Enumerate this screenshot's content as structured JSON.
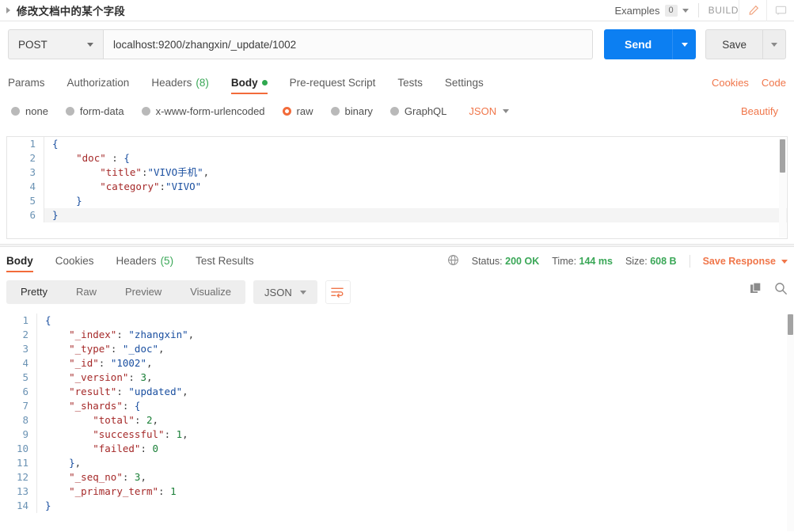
{
  "titlebar": {
    "request_title": "修改文档中的某个字段",
    "examples_label": "Examples",
    "examples_count": "0",
    "build_label": "BUILD",
    "edit_icon": "pencil-icon",
    "comment_icon": "comment-icon"
  },
  "urlbar": {
    "method": "POST",
    "url": "localhost:9200/zhangxin/_update/1002",
    "send_label": "Send",
    "save_label": "Save"
  },
  "request_tabs": {
    "items": [
      {
        "label": "Params",
        "active": false
      },
      {
        "label": "Authorization",
        "active": false
      },
      {
        "label": "Headers",
        "count": "(8)",
        "active": false
      },
      {
        "label": "Body",
        "active": true,
        "dot": true
      },
      {
        "label": "Pre-request Script",
        "active": false
      },
      {
        "label": "Tests",
        "active": false
      },
      {
        "label": "Settings",
        "active": false
      }
    ],
    "cookies_link": "Cookies",
    "code_link": "Code"
  },
  "body_type": {
    "options": [
      {
        "label": "none",
        "selected": false
      },
      {
        "label": "form-data",
        "selected": false
      },
      {
        "label": "x-www-form-urlencoded",
        "selected": false
      },
      {
        "label": "raw",
        "selected": true
      },
      {
        "label": "binary",
        "selected": false
      },
      {
        "label": "GraphQL",
        "selected": false
      }
    ],
    "format": "JSON",
    "beautify_label": "Beautify"
  },
  "request_body": {
    "lines": [
      {
        "no": "1",
        "text": "{"
      },
      {
        "no": "2",
        "text": "    \"doc\" : {"
      },
      {
        "no": "3",
        "text": "        \"title\":\"VIVO手机\","
      },
      {
        "no": "4",
        "text": "        \"category\":\"VIVO\""
      },
      {
        "no": "5",
        "text": "    }"
      },
      {
        "no": "6",
        "text": "}"
      }
    ]
  },
  "response_tabs": {
    "items": [
      {
        "label": "Body",
        "active": true
      },
      {
        "label": "Cookies",
        "active": false
      },
      {
        "label": "Headers",
        "count": "(5)",
        "active": false
      },
      {
        "label": "Test Results",
        "active": false
      }
    ],
    "status_label": "Status:",
    "status_value": "200 OK",
    "time_label": "Time:",
    "time_value": "144 ms",
    "size_label": "Size:",
    "size_value": "608 B",
    "save_response_label": "Save Response",
    "globe_icon": "globe-icon"
  },
  "response_toolbar": {
    "views": [
      {
        "label": "Pretty",
        "active": true
      },
      {
        "label": "Raw",
        "active": false
      },
      {
        "label": "Preview",
        "active": false
      },
      {
        "label": "Visualize",
        "active": false
      }
    ],
    "format": "JSON",
    "wrap_icon": "wrap-lines-icon",
    "copy_icon": "copy-icon",
    "search_icon": "search-icon"
  },
  "response_body": {
    "lines": [
      {
        "no": "1",
        "text": "{"
      },
      {
        "no": "2",
        "text": "    \"_index\": \"zhangxin\","
      },
      {
        "no": "3",
        "text": "    \"_type\": \"_doc\","
      },
      {
        "no": "4",
        "text": "    \"_id\": \"1002\","
      },
      {
        "no": "5",
        "text": "    \"_version\": 3,"
      },
      {
        "no": "6",
        "text": "    \"result\": \"updated\","
      },
      {
        "no": "7",
        "text": "    \"_shards\": {"
      },
      {
        "no": "8",
        "text": "        \"total\": 2,"
      },
      {
        "no": "9",
        "text": "        \"successful\": 1,"
      },
      {
        "no": "10",
        "text": "        \"failed\": 0"
      },
      {
        "no": "11",
        "text": "    },"
      },
      {
        "no": "12",
        "text": "    \"_seq_no\": 3,"
      },
      {
        "no": "13",
        "text": "    \"_primary_term\": 1"
      },
      {
        "no": "14",
        "text": "}"
      }
    ]
  },
  "colors": {
    "accent_orange": "#f26b3a",
    "send_blue": "#0c7ff2",
    "success_green": "#3aa757",
    "json_key": "#a52929",
    "json_string": "#1a4fa0",
    "json_number": "#1a7f37"
  }
}
